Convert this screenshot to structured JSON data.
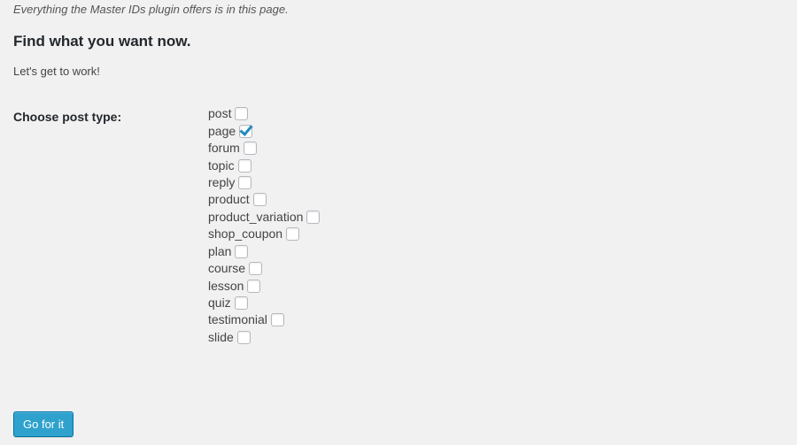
{
  "intro": "Everything the Master IDs plugin offers is in this page.",
  "title": "Find what you want now.",
  "subtitle": "Let's get to work!",
  "post_type": {
    "label": "Choose post type:",
    "options": [
      {
        "label": "post",
        "checked": false
      },
      {
        "label": "page",
        "checked": true
      },
      {
        "label": "forum",
        "checked": false
      },
      {
        "label": "topic",
        "checked": false
      },
      {
        "label": "reply",
        "checked": false
      },
      {
        "label": "product",
        "checked": false
      },
      {
        "label": "product_variation",
        "checked": false
      },
      {
        "label": "shop_coupon",
        "checked": false
      },
      {
        "label": "plan",
        "checked": false
      },
      {
        "label": "course",
        "checked": false
      },
      {
        "label": "lesson",
        "checked": false
      },
      {
        "label": "quiz",
        "checked": false
      },
      {
        "label": "testimonial",
        "checked": false
      },
      {
        "label": "slide",
        "checked": false
      }
    ]
  },
  "submit_label": "Go for it",
  "colors": {
    "background": "#f1f1f1",
    "primary_button": "#2ea2cc",
    "checkmark": "#1e8cbe"
  }
}
